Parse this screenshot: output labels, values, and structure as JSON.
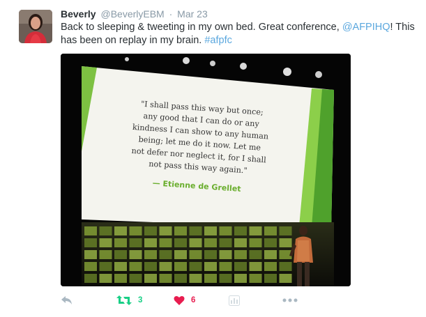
{
  "tweet": {
    "author_name": "Beverly",
    "author_handle": "@BeverlyEBM",
    "separator": "·",
    "date": "Mar 23",
    "text_before": "Back to sleeping & tweeting in my own bed. Great conference, ",
    "mention": "@AFPIHQ",
    "text_middle": "! This has been on replay in my brain. ",
    "hashtag": "#afpfc"
  },
  "slide": {
    "quote_lines": [
      "\"I shall pass this way but once;",
      "any good that I can do or any",
      "kindness I can show to any human",
      "being; let me do it now. Let me",
      "not defer nor neglect it, for I shall",
      "not pass this way again.\""
    ],
    "attribution": "— Etienne de Grellet"
  },
  "actions": {
    "retweet_count": "3",
    "like_count": "6"
  },
  "colors": {
    "link": "#5aa7de",
    "retweet": "#19cf86",
    "like": "#e81c4f",
    "icon": "#aab8c2",
    "slide_green": "#7dc142"
  }
}
